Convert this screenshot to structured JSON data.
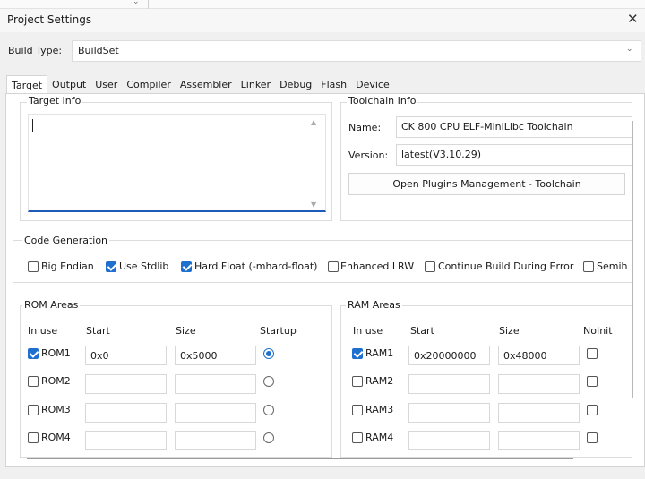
{
  "window": {
    "title": "Project Settings"
  },
  "build_type": {
    "label": "Build Type:",
    "value": "BuildSet"
  },
  "tabs": [
    {
      "label": "Target"
    },
    {
      "label": "Output"
    },
    {
      "label": "User"
    },
    {
      "label": "Compiler"
    },
    {
      "label": "Assembler"
    },
    {
      "label": "Linker"
    },
    {
      "label": "Debug"
    },
    {
      "label": "Flash"
    },
    {
      "label": "Device"
    }
  ],
  "target_info": {
    "label": "Target Info",
    "value": ""
  },
  "toolchain": {
    "label": "Toolchain Info",
    "name_label": "Name:",
    "name_value": "CK 800 CPU ELF-MiniLibc Toolchain",
    "version_label": "Version:",
    "version_value": "latest(V3.10.29)",
    "button": "Open Plugins Management - Toolchain"
  },
  "code_generation": {
    "label": "Code Generation",
    "options": [
      {
        "label": "Big Endian",
        "checked": false
      },
      {
        "label": "Use Stdlib",
        "checked": true
      },
      {
        "label": "Hard Float (-mhard-float)",
        "checked": true
      },
      {
        "label": "Enhanced LRW",
        "checked": false
      },
      {
        "label": "Continue Build During Error",
        "checked": false
      },
      {
        "label": "Semih",
        "checked": false
      }
    ]
  },
  "rom": {
    "label": "ROM Areas",
    "headers": {
      "inuse": "In use",
      "start": "Start",
      "size": "Size",
      "extra": "Startup"
    },
    "rows": [
      {
        "name": "ROM1",
        "checked": true,
        "start": "0x0",
        "size": "0x5000",
        "startup": true
      },
      {
        "name": "ROM2",
        "checked": false,
        "start": "",
        "size": "",
        "startup": false
      },
      {
        "name": "ROM3",
        "checked": false,
        "start": "",
        "size": "",
        "startup": false
      },
      {
        "name": "ROM4",
        "checked": false,
        "start": "",
        "size": "",
        "startup": false
      }
    ]
  },
  "ram": {
    "label": "RAM Areas",
    "headers": {
      "inuse": "In use",
      "start": "Start",
      "size": "Size",
      "extra": "NoInit"
    },
    "rows": [
      {
        "name": "RAM1",
        "checked": true,
        "start": "0x20000000",
        "size": "0x48000",
        "noinit": false
      },
      {
        "name": "RAM2",
        "checked": false,
        "start": "",
        "size": "",
        "noinit": false
      },
      {
        "name": "RAM3",
        "checked": false,
        "start": "",
        "size": "",
        "noinit": false
      },
      {
        "name": "RAM4",
        "checked": false,
        "start": "",
        "size": "",
        "noinit": false
      }
    ]
  },
  "colors": {
    "accent": "#1f6fcf",
    "focus": "#1e5bb8"
  }
}
